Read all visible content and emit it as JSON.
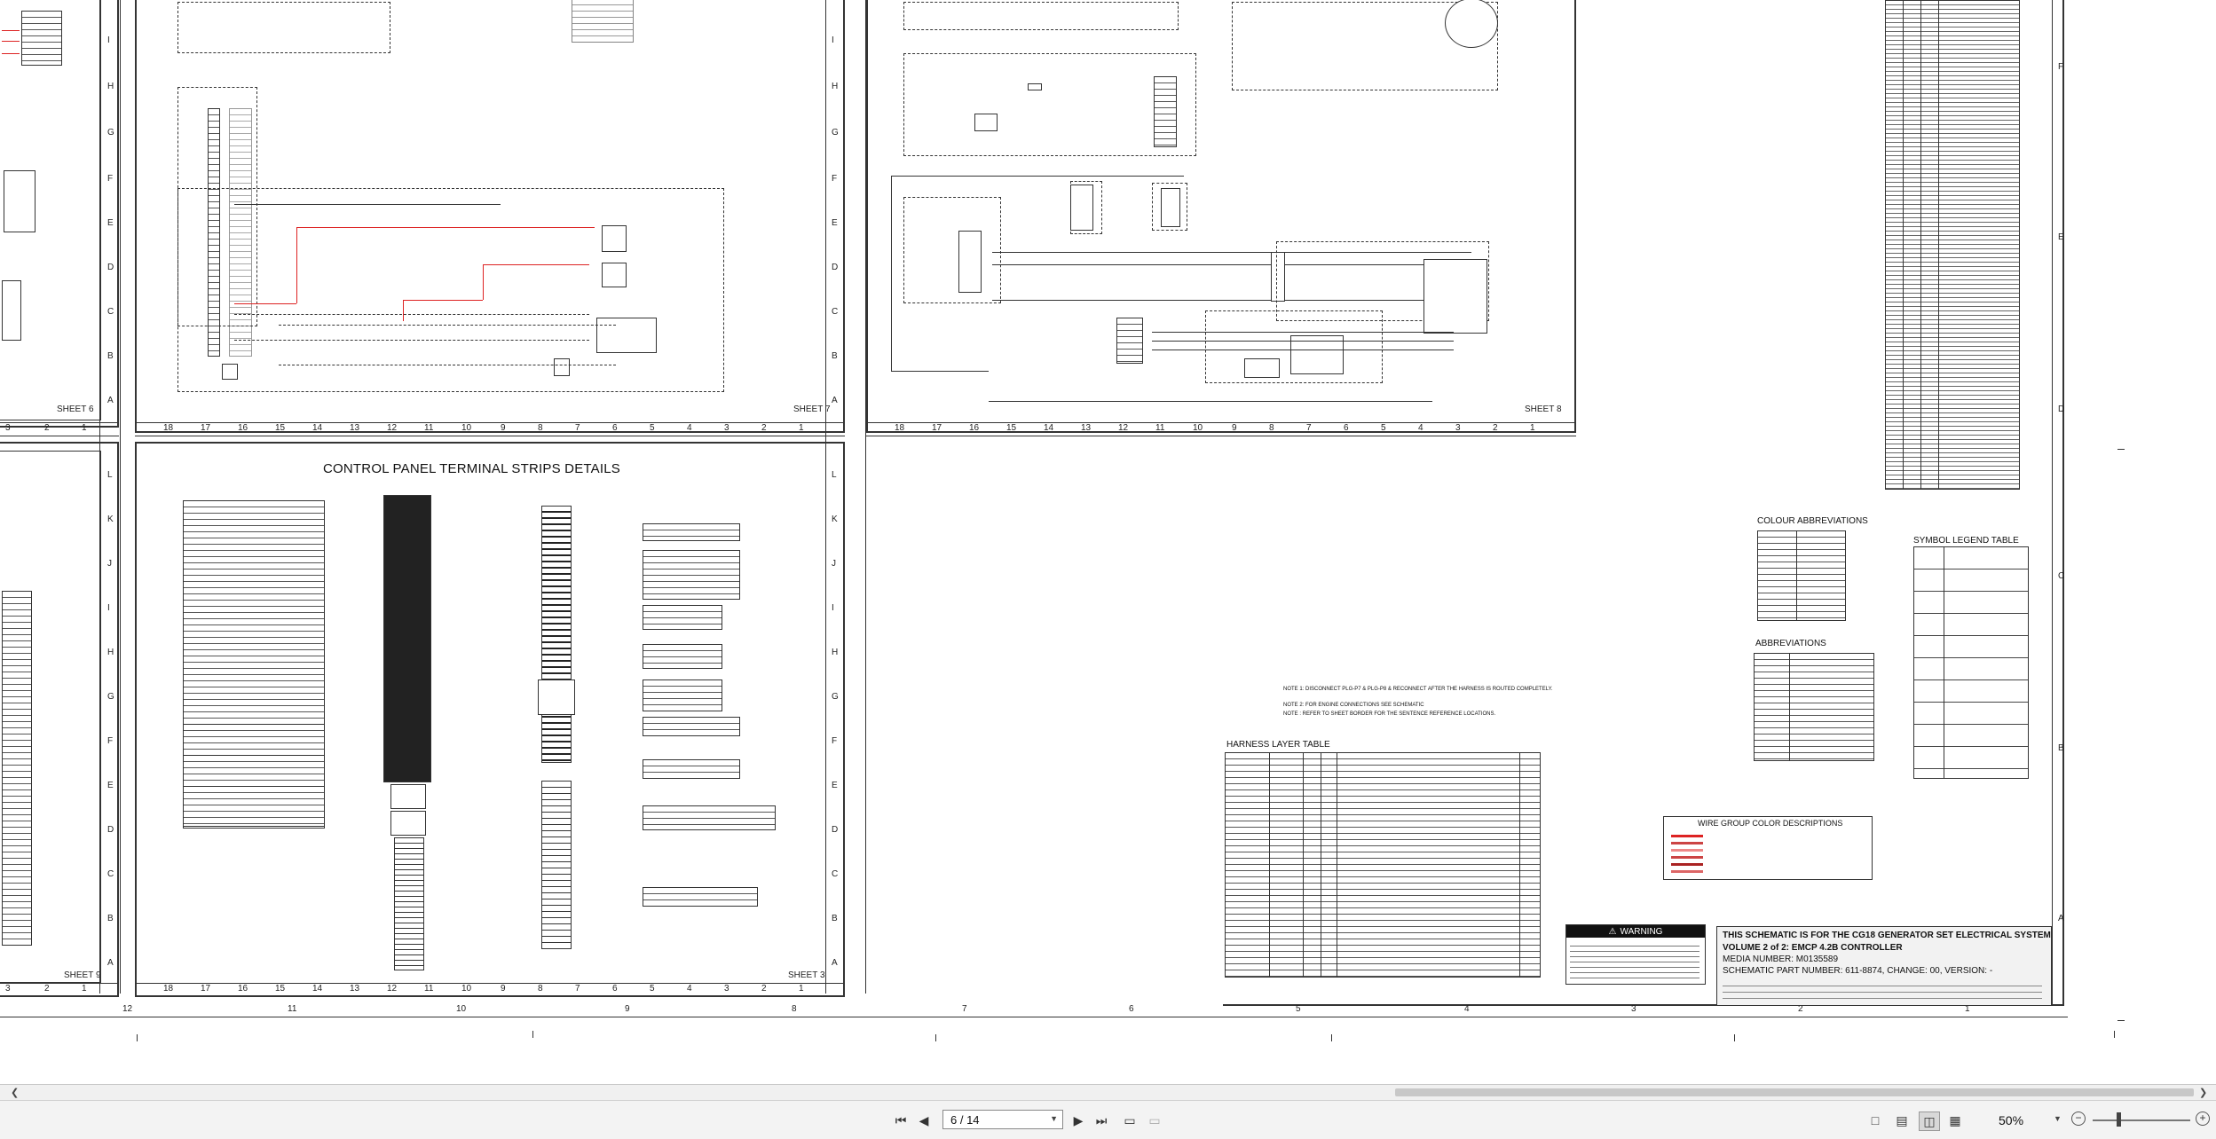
{
  "document": {
    "sheets": [
      {
        "id": "sheet6",
        "label": "SHEET 6"
      },
      {
        "id": "sheet7",
        "label": "SHEET 7"
      },
      {
        "id": "sheet8",
        "label": "SHEET 8"
      },
      {
        "id": "sheet9",
        "label": "SHEET 9"
      },
      {
        "id": "sheet3",
        "label": "SHEET 3"
      }
    ],
    "column_numbers_18": [
      "18",
      "17",
      "16",
      "15",
      "14",
      "13",
      "12",
      "11",
      "10",
      "9",
      "8",
      "7",
      "6",
      "5",
      "4",
      "3",
      "2",
      "1"
    ],
    "row_letters_upper": [
      "I",
      "H",
      "G",
      "F",
      "E",
      "D",
      "C",
      "B",
      "A"
    ],
    "row_letters_lower": [
      "L",
      "K",
      "J",
      "I",
      "H",
      "G",
      "F",
      "E",
      "D",
      "C",
      "B",
      "A"
    ],
    "left_partial_cols": [
      "3",
      "2",
      "1"
    ],
    "big_frame_cols": [
      "12",
      "11",
      "10",
      "9",
      "8",
      "7",
      "6",
      "5",
      "4",
      "3",
      "2",
      "1"
    ],
    "big_frame_rows": [
      "F",
      "E",
      "D",
      "C",
      "B",
      "A"
    ],
    "terminal_strips_title": "CONTROL PANEL TERMINAL STRIPS DETAILS",
    "harness_title": "HARNESS LAYER TABLE",
    "colour_abbrev_title": "COLOUR ABBREVIATIONS",
    "abbrev_title": "ABBREVIATIONS",
    "symbol_legend_title": "SYMBOL LEGEND TABLE",
    "wire_group_title": "WIRE GROUP COLOR DESCRIPTIONS",
    "warning_label": "WARNING",
    "title_block": {
      "line1": "THIS SCHEMATIC IS FOR THE CG18 GENERATOR SET ELECTRICAL SYSTEM",
      "line2": "VOLUME 2 of 2: EMCP 4.2B CONTROLLER",
      "line3": "MEDIA NUMBER: M0135589",
      "line4": "SCHEMATIC PART NUMBER: 611-8874, CHANGE: 00, VERSION: -"
    },
    "notes": [
      "NOTE 1: DISCONNECT PLG-P7 & PLG-P8 & RECONNECT AFTER THE HARNESS IS ROUTED COMPLETELY.",
      "NOTE 2: FOR ENGINE CONNECTIONS SEE SCHEMATIC",
      "NOTE : REFER TO SHEET BORDER FOR THE SENTENCE REFERENCE LOCATIONS."
    ]
  },
  "viewer": {
    "page_current": "6 / 14",
    "zoom": "50%"
  }
}
